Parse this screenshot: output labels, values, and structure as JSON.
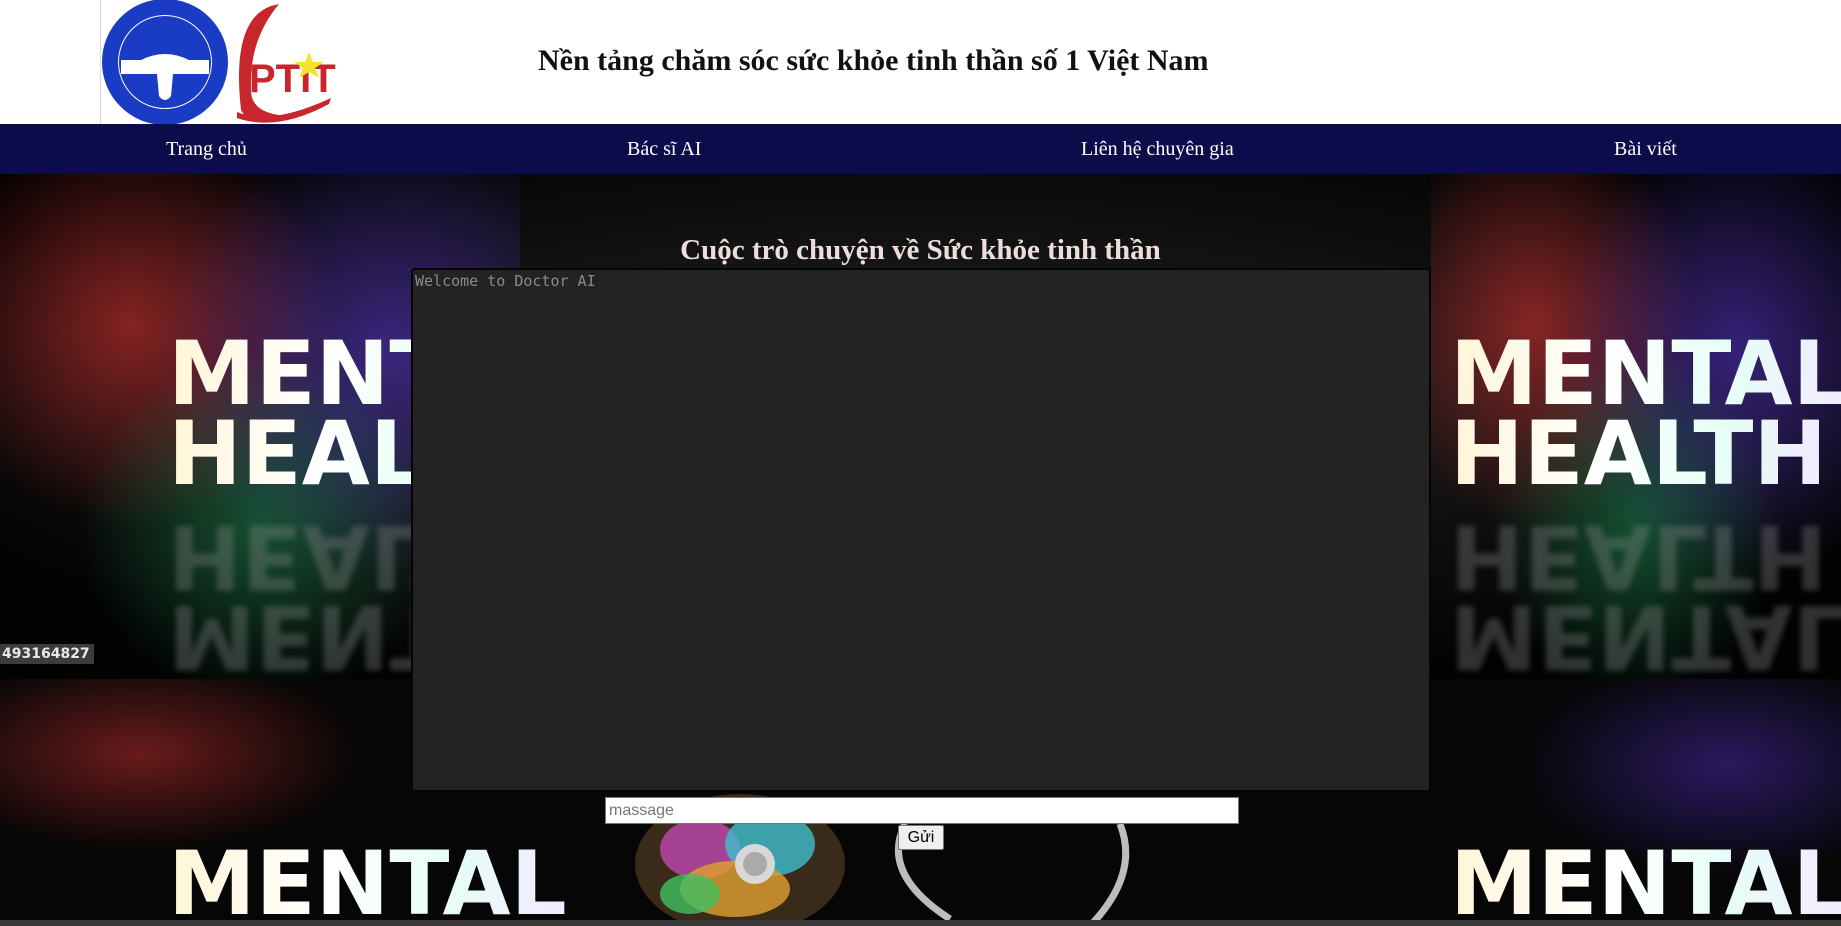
{
  "header": {
    "logo_text": "PTIT",
    "site_title": "Nền tảng chăm sóc sức khỏe tinh thần số 1 Việt Nam"
  },
  "nav": {
    "items": [
      {
        "label": "Trang chủ"
      },
      {
        "label": "Bác sĩ AI"
      },
      {
        "label": "Liên hệ chuyên gia"
      },
      {
        "label": "Bài viết"
      }
    ]
  },
  "background": {
    "banner_word_1": "MENTAL",
    "banner_word_2": "HEALTH",
    "overlay_tag": "493164827"
  },
  "chat": {
    "title": "Cuộc trò chuyện về Sức khỏe tinh thần",
    "box_placeholder": "Welcome to Doctor AI",
    "input_placeholder": "massage",
    "send_label": "Gửi"
  },
  "colors": {
    "nav_bg": "#0c0c4a",
    "logo_blue": "#1a3bc4",
    "logo_red": "#c8262c",
    "logo_star": "#f5e52a",
    "chat_bg": "#232323"
  }
}
